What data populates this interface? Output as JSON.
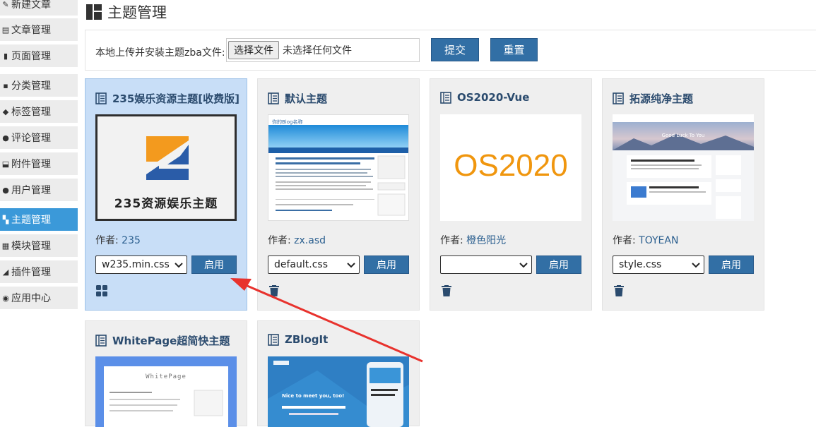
{
  "sidebar": {
    "items": [
      {
        "label": "新建文章",
        "icon": "pencil-icon"
      },
      {
        "label": "文章管理",
        "icon": "article-icon"
      },
      {
        "label": "页面管理",
        "icon": "page-icon"
      },
      {
        "label": "分类管理",
        "icon": "folder-icon"
      },
      {
        "label": "标签管理",
        "icon": "tag-icon"
      },
      {
        "label": "评论管理",
        "icon": "comment-icon"
      },
      {
        "label": "附件管理",
        "icon": "attachment-icon"
      },
      {
        "label": "用户管理",
        "icon": "user-icon"
      },
      {
        "label": "主题管理",
        "icon": "theme-icon",
        "active": true
      },
      {
        "label": "模块管理",
        "icon": "module-icon"
      },
      {
        "label": "插件管理",
        "icon": "plugin-icon"
      },
      {
        "label": "应用中心",
        "icon": "app-center-icon"
      }
    ]
  },
  "header": {
    "title": "主题管理"
  },
  "upload": {
    "label": "本地上传并安装主题zba文件:",
    "choose_label": "选择文件",
    "no_file_label": "未选择任何文件",
    "submit_label": "提交",
    "reset_label": "重置"
  },
  "themes": [
    {
      "name": "235娱乐资源主题[收费版]",
      "author_label": "作者:",
      "author": "235",
      "css": "w235.min.css",
      "enable_label": "启用",
      "active": true,
      "thumb_text": "235资源娱乐主题"
    },
    {
      "name": "默认主题",
      "author_label": "作者:",
      "author": "zx.asd",
      "css": "default.css",
      "enable_label": "启用",
      "thumb_header": "你的Blog名称"
    },
    {
      "name": "OS2020-Vue",
      "author_label": "作者:",
      "author": "橙色阳光",
      "css": "",
      "enable_label": "启用",
      "thumb_text": "OS2020"
    },
    {
      "name": "拓源纯净主题",
      "author_label": "作者:",
      "author": "TOYEAN",
      "css": "style.css",
      "enable_label": "启用",
      "thumb_banner": "Good Luck To You"
    },
    {
      "name": "WhitePage超简快主题",
      "thumb_text": "WhitePage"
    },
    {
      "name": "ZBlogIt",
      "thumb_text": "Nice to meet you, too!"
    }
  ],
  "colors": {
    "accent": "#326fa5",
    "active_nav": "#3b99d9",
    "active_card": "#c8def7",
    "arrow": "#e8322d"
  }
}
